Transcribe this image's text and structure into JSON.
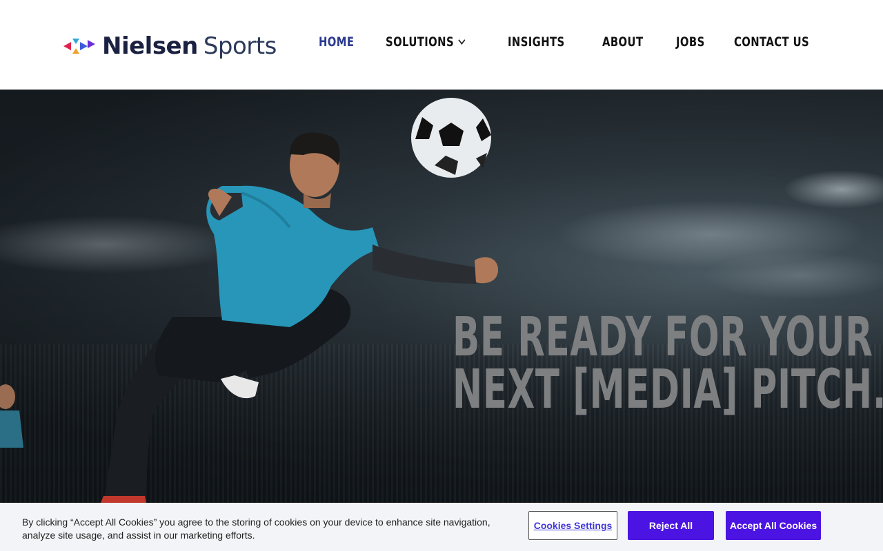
{
  "header": {
    "logo": {
      "brand": "Nielsen",
      "product": "Sports"
    },
    "nav": [
      {
        "label": "HOME",
        "active": true
      },
      {
        "label": "SOLUTIONS",
        "has_dropdown": true
      },
      {
        "label": "INSIGHTS"
      },
      {
        "label": "ABOUT"
      },
      {
        "label": "JOBS"
      },
      {
        "label": "CONTACT US"
      }
    ]
  },
  "hero": {
    "headline_line1": "BE READY FOR YOUR",
    "headline_line2": "NEXT [MEDIA] PITCH."
  },
  "cookie_banner": {
    "text": "By clicking “Accept All Cookies” you agree to the storing of cookies on your device to enhance site navigation, analyze site usage, and assist in our marketing efforts.",
    "settings_label": "Cookies Settings",
    "reject_label": "Reject All",
    "accept_label": "Accept All Cookies"
  },
  "colors": {
    "nav_active": "#2b3a8f",
    "cookie_button": "#4c14e3",
    "headline": "#7d7f81"
  },
  "icons": {
    "logo_mark": "nielsen-play-arrows-icon",
    "dropdown": "chevron-down-icon"
  }
}
